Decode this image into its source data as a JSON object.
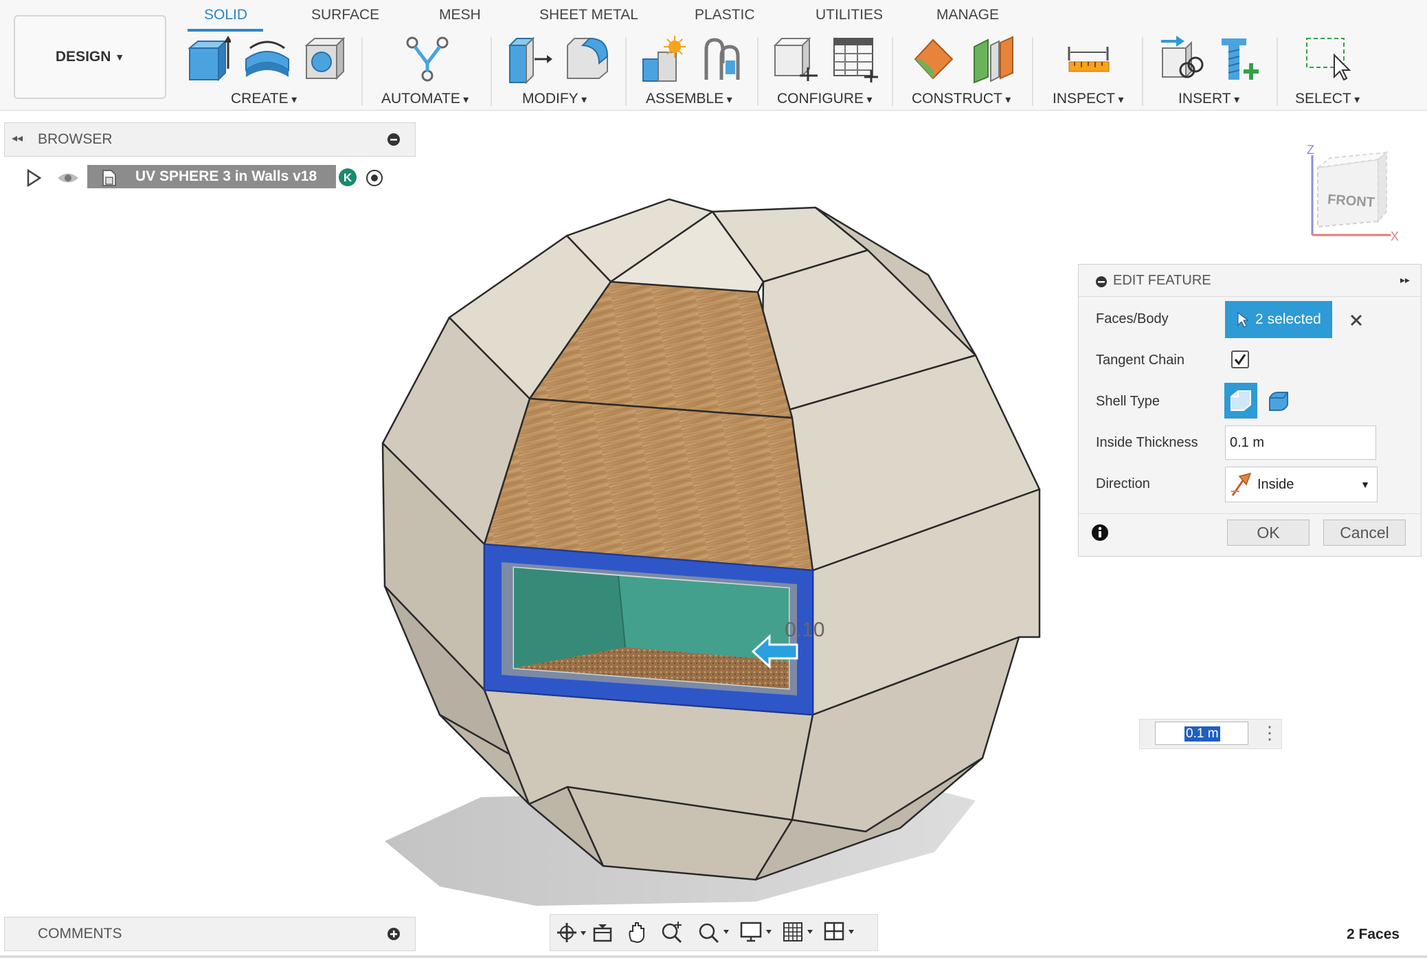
{
  "toolbar": {
    "design_label": "DESIGN",
    "tabs": [
      "SOLID",
      "SURFACE",
      "MESH",
      "SHEET METAL",
      "PLASTIC",
      "UTILITIES",
      "MANAGE"
    ],
    "active_tab": "SOLID",
    "groups": [
      "CREATE",
      "AUTOMATE",
      "MODIFY",
      "ASSEMBLE",
      "CONFIGURE",
      "CONSTRUCT",
      "INSPECT",
      "INSERT",
      "SELECT"
    ]
  },
  "browser": {
    "title": "BROWSER",
    "document_name": "UV SPHERE 3 in Walls v18",
    "badge": "K"
  },
  "comments": {
    "title": "COMMENTS"
  },
  "viewcube": {
    "face": "FRONT",
    "axis_z": "Z",
    "axis_x": "X"
  },
  "viewport": {
    "dimension_label": "0.10"
  },
  "edit_feature": {
    "title": "EDIT FEATURE",
    "faces_label": "Faces/Body",
    "faces_value": "2 selected",
    "tangent_label": "Tangent Chain",
    "tangent_checked": true,
    "shell_label": "Shell Type",
    "thickness_label": "Inside Thickness",
    "thickness_value": "0.1 m",
    "direction_label": "Direction",
    "direction_value": "Inside",
    "ok": "OK",
    "cancel": "Cancel"
  },
  "floating_input": {
    "value": "0.1 m"
  },
  "status": {
    "text": "2 Faces"
  },
  "colors": {
    "accent": "#2e9ad6",
    "selection": "#2f56c8",
    "wood": "#b98e5e",
    "interior": "#3f9a86"
  }
}
